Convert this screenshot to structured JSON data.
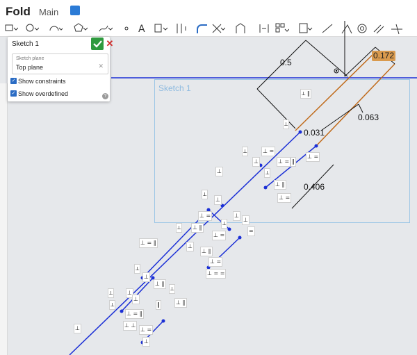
{
  "header": {
    "doc_title": "Fold",
    "branch": "Main"
  },
  "toolbar": {
    "tools": [
      "line-icon",
      "circle-icon",
      "arc-icon",
      "polygon-icon",
      "spline-icon",
      "point-icon",
      "text-icon",
      "offset-icon",
      "mirror-icon",
      "fillet-icon",
      "trim-icon",
      "use-icon",
      "dimension-icon",
      "pattern-icon",
      "dxf-icon",
      "tangent-icon",
      "coincident-icon",
      "concentric-icon",
      "parallel-icon",
      "horizontal-icon"
    ]
  },
  "panel": {
    "title": "Sketch 1",
    "plane_label": "Sketch plane",
    "plane_value": "Top plane",
    "show_constraints": "Show constraints",
    "show_overdefined": "Show overdefined"
  },
  "canvas": {
    "sketch_name": "Sketch 1",
    "dimensions": {
      "d1": "0.5",
      "d2": "0.172",
      "d3": "0.063",
      "d4": "0.031",
      "d5": "0.406"
    }
  },
  "colors": {
    "accent": "#2b6cc4",
    "sketch_line": "#1b2fd6",
    "edge": "#c06a1a",
    "ok": "#2e9a3e"
  }
}
